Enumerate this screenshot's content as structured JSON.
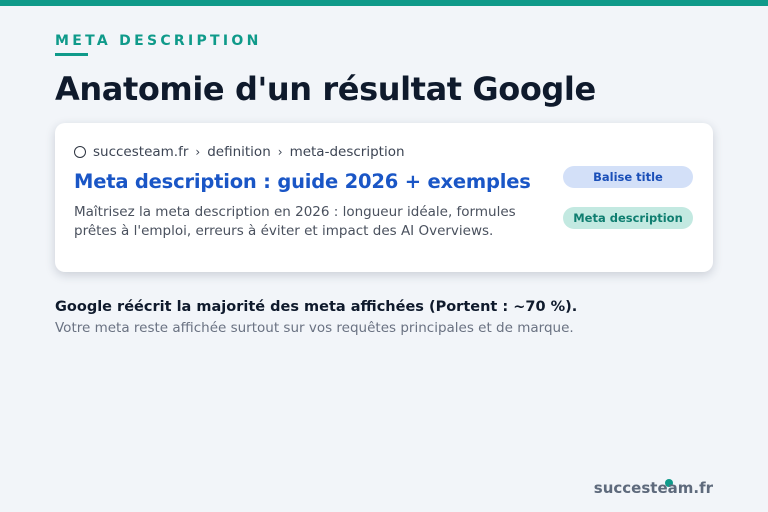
{
  "header": {
    "eyebrow": "META DESCRIPTION",
    "title": "Anatomie d'un résultat Google"
  },
  "serp_result": {
    "favicon_icon": "globe-outline-icon",
    "breadcrumb": [
      "succesteam.fr",
      "definition",
      "meta-description"
    ],
    "breadcrumb_separator": "›",
    "title": "Meta description : guide 2026 + exemples",
    "description_lines": [
      "Maîtrisez la meta description en 2026 : longueur idéale, formules",
      "prêtes à l'emploi, erreurs à éviter et impact des AI Overviews."
    ]
  },
  "badges": {
    "title_tag": "Balise title",
    "meta_description": "Meta description"
  },
  "notes": {
    "headline": "Google réécrit la majorité des meta affichées (Portent : ~70 %).",
    "subline": "Votre meta reste affichée surtout sur vos requêtes principales et de marque."
  },
  "footer": {
    "brand": "succesteam.fr"
  },
  "colors": {
    "accent": "#0f9a8a",
    "link_blue": "#1a56c6",
    "background": "#f2f5f9",
    "title_text": "#0f1a2c"
  }
}
